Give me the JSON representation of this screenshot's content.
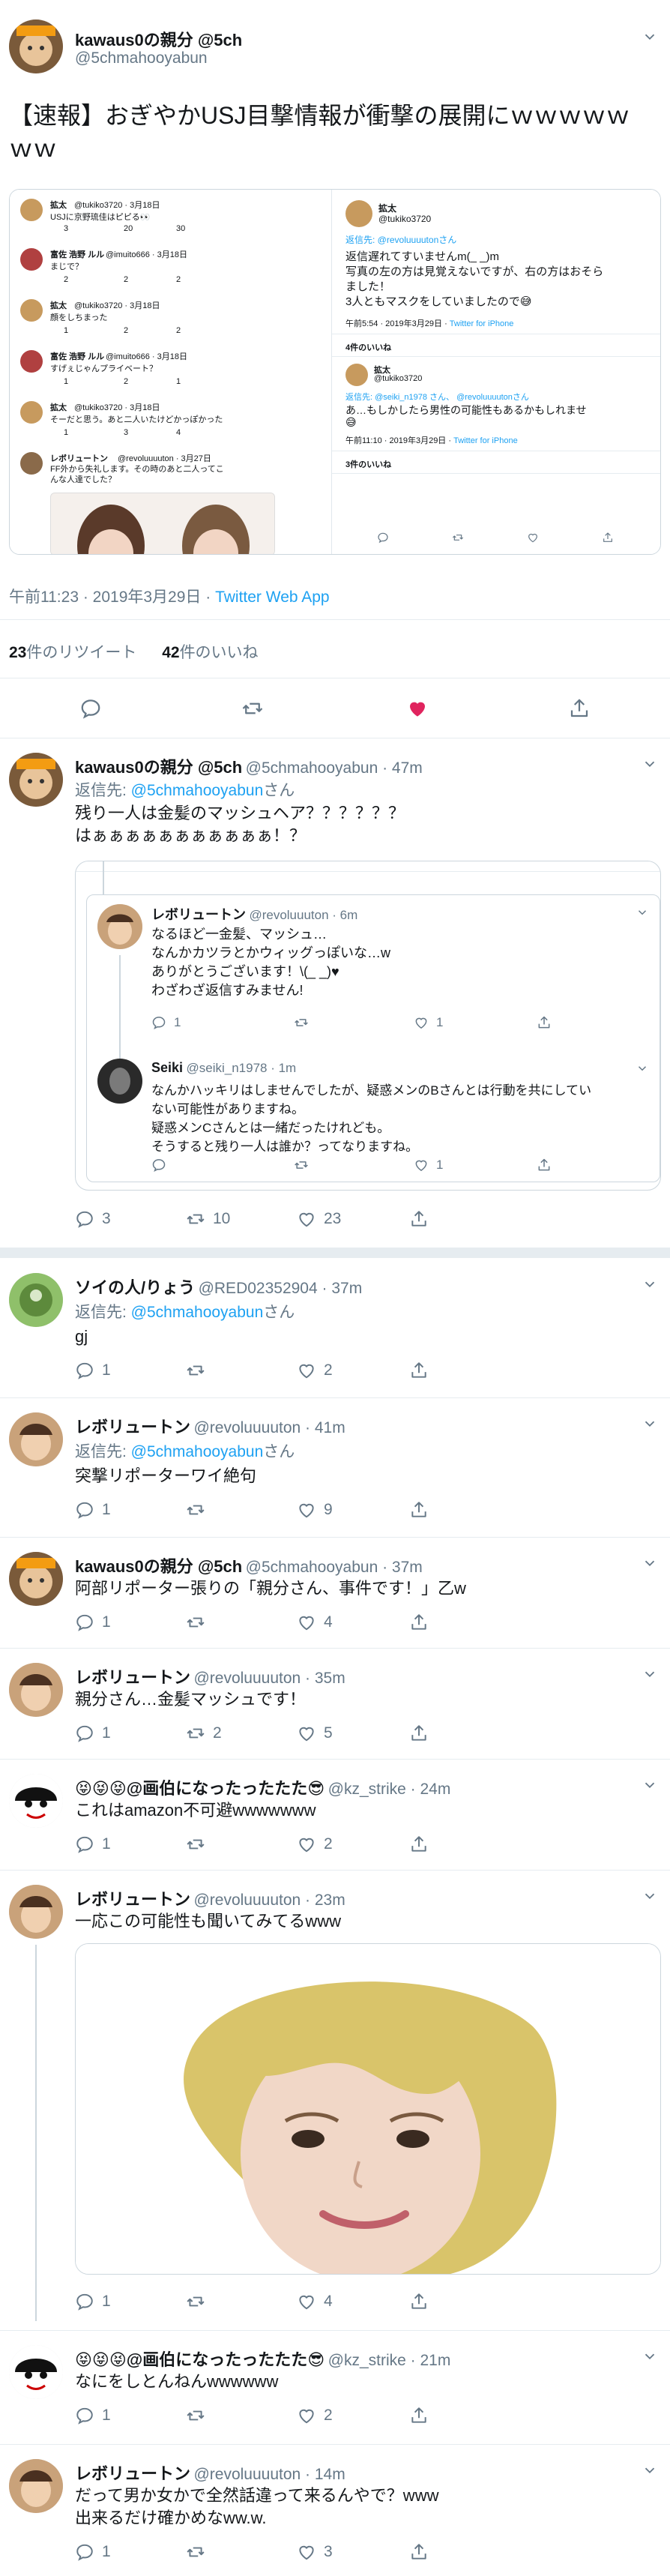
{
  "main": {
    "author_name": "kawaus0の親分 @5ch",
    "author_handle": "@5chmahooyabun",
    "text_line1": "【速報】おぎやかUSJ目撃情報が衝撃の展開にｗｗｗｗｗ",
    "text_line2": "ｗｗ",
    "time": "午前11:23 · 2019年3月29日 · ",
    "source": "Twitter Web App",
    "retweets_count": "23",
    "retweets_label": "件のリツイート",
    "likes_count": "42",
    "likes_label": "件のいいね",
    "like_color": "#e0245e",
    "screenshot": {
      "left": [
        {
          "name": "拡太",
          "meta": "@tukiko3720 · 3月18日",
          "text": "USJに京野琉佳はピピる👀",
          "counts": [
            "3",
            "20",
            "30"
          ]
        },
        {
          "name": "富佐 浩野 ルル",
          "meta": "@imuito666 · 3月18日",
          "text": "まじで？",
          "counts": [
            "2",
            "2",
            "2"
          ]
        },
        {
          "name": "拡太",
          "meta": "@tukiko3720 · 3月18日",
          "text": "顔をしちまった",
          "counts": [
            "1",
            "2",
            "2"
          ]
        },
        {
          "name": "富佐 浩野 ルル",
          "meta": "@imuito666 · 3月18日",
          "text": "すげぇじゃんプライベート？",
          "counts": [
            "1",
            "2",
            "1"
          ]
        },
        {
          "name": "拡太",
          "meta": "@tukiko3720 · 3月18日",
          "text": "そーだと思う。あと二人いたけどかっぽかった",
          "counts": [
            "1",
            "3",
            "4"
          ]
        },
        {
          "name": "レボリュートン",
          "meta": "@revoluuuuton · 3月27日",
          "text": "FF外から失礼します。その時のあと二人ってこんな人達でした？",
          "counts": []
        }
      ],
      "right": {
        "name": "拡太",
        "handle": "@tukiko3720",
        "reply_to": "返信先: @revoluuuutonさん",
        "lines": [
          "返信遅れてすいませんm(_ _)m",
          "写真の左の方は見覚えないですが、右の方はおそら",
          "ました！",
          "3人ともマスクをしていましたので😅"
        ],
        "time": "午前5:54 · 2019年3月29日 · ",
        "source": "Twitter for iPhone",
        "likes": "4件のいいね",
        "reply2_name": "拡太",
        "reply2_handle": "@tukiko3720",
        "reply2_to": "返信先: @seiki_n1978 さん、 @revoluuuutonさん",
        "reply2_text": "あ…もしかしたら男性の可能性もあるかもしれませ",
        "reply2_emoji": "😅",
        "reply2_time": "午前11:10 · 2019年3月29日 · ",
        "reply2_source": "Twitter for iPhone",
        "reply2_likes": "3件のいいね"
      }
    }
  },
  "replies": [
    {
      "name": "kawaus0の親分 @5ch",
      "handle": "@5chmahooyabun · 47m",
      "reply_prefix": "返信先: ",
      "reply_to": "@5chmahooyabun",
      "reply_suffix": "さん",
      "lines": [
        "残り一人は金髪のマッシュヘア？？？？？？",
        "はぁぁぁぁぁぁぁぁぁぁぁ！？"
      ],
      "quoted": [
        {
          "name": "レボリュートン",
          "meta": "@revoluuuton · 6m",
          "lines": [
            "なるほど一金髪、マッシュ…",
            "なんかカツラとかウィッグっぽいな…w",
            "ありがとうございます！\\(_ _)♥",
            "わざわざ返信すみません!"
          ],
          "counts": [
            "1",
            "",
            "1"
          ]
        },
        {
          "name": "Seiki",
          "meta": "@seiki_n1978 · 1m",
          "lines": [
            "なんかハッキリはしませんでしたが、疑惑メンのBさんとは行動を共にしてい",
            "ない可能性がありますね。",
            "疑惑メンCさんとは一緒だったけれども。",
            "そうすると残り一人は誰か？ってなりますね。"
          ],
          "counts": [
            "",
            "",
            "1"
          ]
        }
      ],
      "counts": [
        "3",
        "10",
        "23"
      ]
    },
    {
      "name": "ソイの人/りょう",
      "handle": "@RED02352904 · 37m",
      "reply_prefix": "返信先: ",
      "reply_to": "@5chmahooyabun",
      "reply_suffix": "さん",
      "lines": [
        "gj"
      ],
      "counts": [
        "1",
        "",
        "2"
      ]
    },
    {
      "name": "レボリュートン",
      "handle": "@revoluuuuton · 41m",
      "reply_prefix": "返信先: ",
      "reply_to": "@5chmahooyabun",
      "reply_suffix": "さん",
      "lines": [
        "突撃リポーターワイ絶句"
      ],
      "counts": [
        "1",
        "",
        "9"
      ]
    },
    {
      "name": "kawaus0の親分 @5ch",
      "handle": "@5chmahooyabun · 37m",
      "lines": [
        "阿部リポーター張りの「親分さん、事件です！」乙w"
      ],
      "counts": [
        "1",
        "",
        "4"
      ]
    },
    {
      "name": "レボリュートン",
      "handle": "@revoluuuuton · 35m",
      "lines": [
        "親分さん…金髪マッシュです！"
      ],
      "counts": [
        "1",
        "2",
        "5"
      ]
    },
    {
      "name": "😝😝😝@画伯になったったたた😎",
      "handle": "@kz_strike · 24m",
      "lines": [
        "これはamazon不可避wwwwwww"
      ],
      "counts": [
        "1",
        "",
        "2"
      ]
    },
    {
      "name": "レボリュートン",
      "handle": "@revoluuuuton · 23m",
      "lines": [
        "一応この可能性も聞いてみてるwww"
      ],
      "counts": [
        "1",
        "",
        "4"
      ]
    },
    {
      "name": "😝😝😝@画伯になったったたた😎",
      "handle": "@kz_strike · 21m",
      "lines": [
        "なにをしとんねんwwwwww"
      ],
      "counts": [
        "1",
        "",
        "2"
      ]
    },
    {
      "name": "レボリュートン",
      "handle": "@revoluuuuton · 14m",
      "lines": [
        "だって男か女かで全然話違って来るんやで？www",
        "出来るだけ確かめなww.w."
      ],
      "counts": [
        "1",
        "",
        "3"
      ]
    }
  ],
  "icons": [
    "reply-icon",
    "retweet-icon",
    "like-icon",
    "share-icon",
    "chevron-down-icon"
  ]
}
